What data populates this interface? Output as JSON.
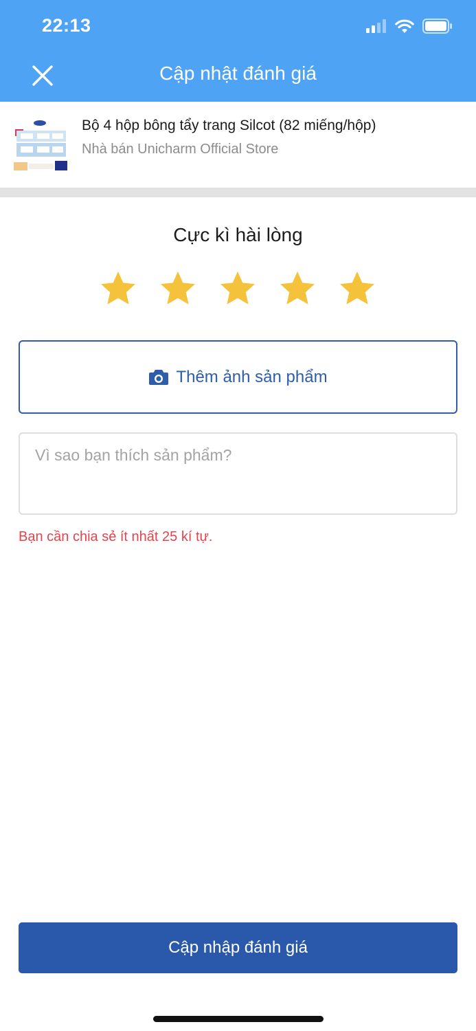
{
  "status_bar": {
    "time": "22:13"
  },
  "header": {
    "title": "Cập nhật đánh giá"
  },
  "product": {
    "name": "Bộ 4 hộp bông tẩy trang Silcot (82 miếng/hộp)",
    "seller": "Nhà bán Unicharm Official Store"
  },
  "rating": {
    "label": "Cực kì hài lòng",
    "value": 5,
    "max": 5,
    "star_color": "#f5c33b"
  },
  "photo_button": {
    "label": "Thêm ảnh sản phẩm"
  },
  "review": {
    "placeholder": "Vì sao bạn thích sản phẩm?",
    "value": ""
  },
  "error": {
    "message": "Bạn cần chia sẻ ít nhất 25 kí tự."
  },
  "submit": {
    "label": "Cập nhập đánh giá"
  },
  "colors": {
    "header_bg": "#4fa3f4",
    "primary": "#2a58aa",
    "error": "#e5434b"
  }
}
